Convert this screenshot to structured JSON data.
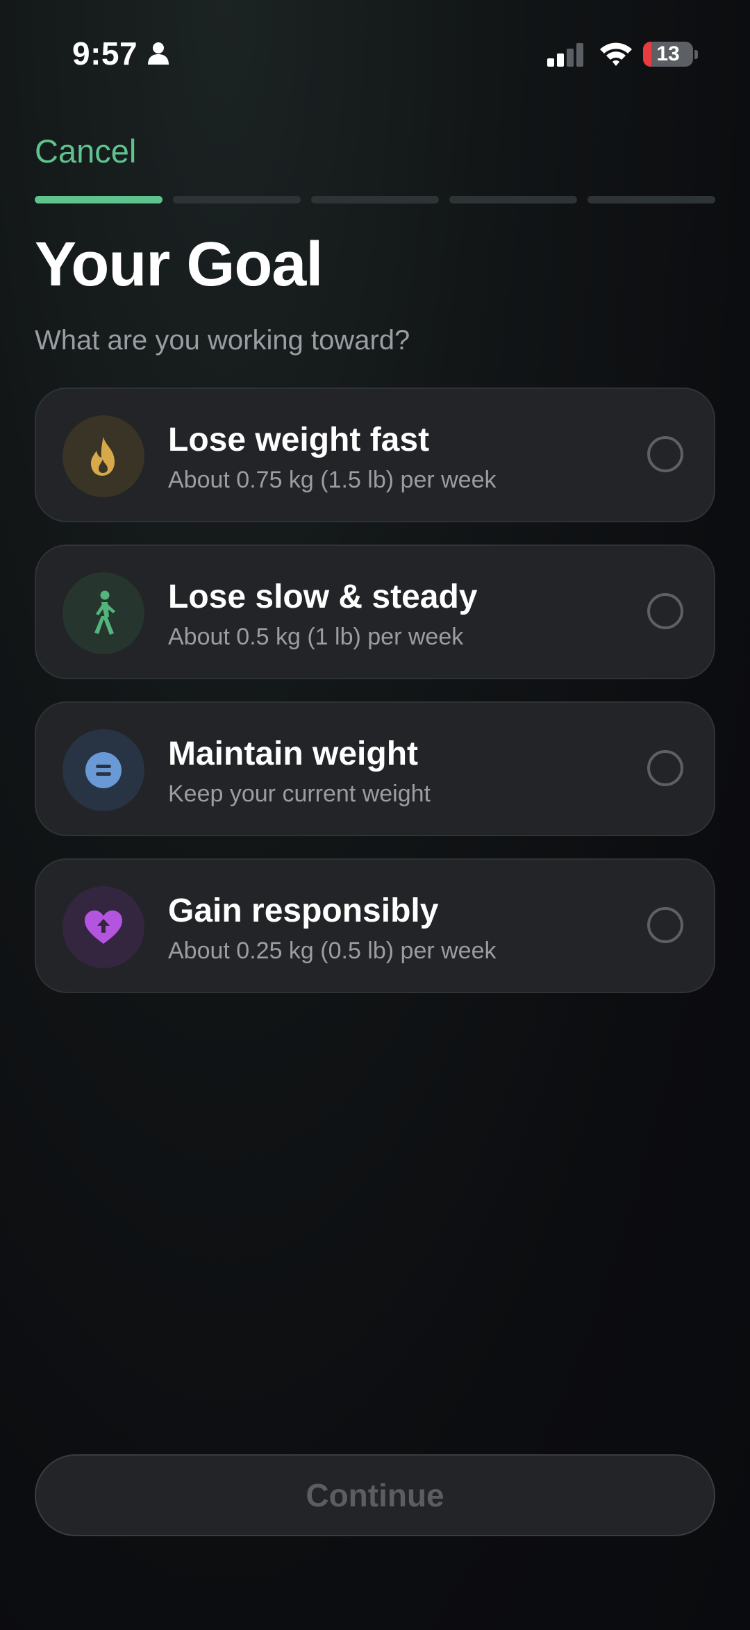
{
  "status_bar": {
    "time": "9:57",
    "battery": "13"
  },
  "header": {
    "cancel_label": "Cancel",
    "progress": {
      "current_step": 1,
      "total_steps": 5
    }
  },
  "title": "Your Goal",
  "subtitle": "What are you working toward?",
  "options": [
    {
      "title": "Lose weight fast",
      "subtitle": "About 0.75 kg (1.5 lb) per week",
      "icon": "flame-icon",
      "icon_color": "#d7a94a",
      "icon_bg": "#3a3426"
    },
    {
      "title": "Lose slow & steady",
      "subtitle": "About 0.5 kg (1 lb) per week",
      "icon": "walking-icon",
      "icon_color": "#54b57c",
      "icon_bg": "#26352d"
    },
    {
      "title": "Maintain weight",
      "subtitle": "Keep your current weight",
      "icon": "equals-icon",
      "icon_color": "#6a9ad6",
      "icon_bg": "#283444"
    },
    {
      "title": "Gain responsibly",
      "subtitle": "About 0.25 kg (0.5 lb) per week",
      "icon": "heart-arrow-icon",
      "icon_color": "#b455e0",
      "icon_bg": "#352640"
    }
  ],
  "continue_label": "Continue",
  "colors": {
    "accent": "#5fc38e",
    "card_bg": "#222427",
    "battery_low": "#ea3b3f"
  }
}
